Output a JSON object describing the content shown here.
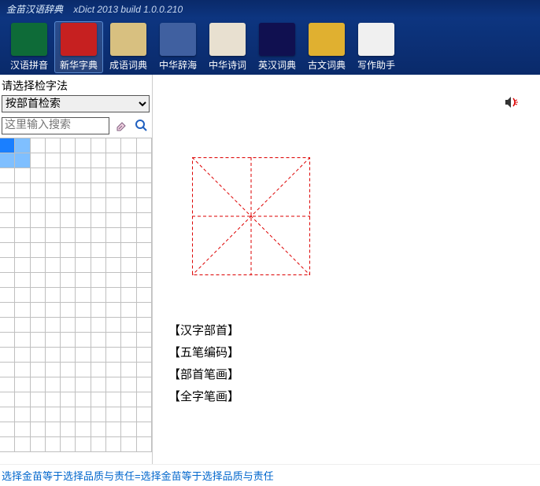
{
  "title": {
    "product": "金苗汉语辞典",
    "version": "xDict 2013  build 1.0.0.210"
  },
  "tools": [
    {
      "label": "汉语拼音",
      "name": "tool-pinyin",
      "bg": "#0e6b38"
    },
    {
      "label": "新华字典",
      "name": "tool-xinhua",
      "bg": "#c62020",
      "selected": true
    },
    {
      "label": "成语词典",
      "name": "tool-chengyu",
      "bg": "#d8c080"
    },
    {
      "label": "中华辞海",
      "name": "tool-cihai",
      "bg": "#4060a0"
    },
    {
      "label": "中华诗词",
      "name": "tool-shici",
      "bg": "#e8e0d0"
    },
    {
      "label": "英汉词典",
      "name": "tool-eng",
      "bg": "#101050"
    },
    {
      "label": "古文词典",
      "name": "tool-guwen",
      "bg": "#e0b030"
    },
    {
      "label": "写作助手",
      "name": "tool-write",
      "bg": "#f0f0f0"
    }
  ],
  "left": {
    "prompt": "请选择检字法",
    "method_selected": "按部首检索",
    "methods": [
      "按部首检索"
    ],
    "search_placeholder": "这里输入搜索"
  },
  "fields": {
    "bushou": "【汉字部首】",
    "wubi": "【五笔编码】",
    "bushou_bihua": "【部首笔画】",
    "quanzi_bihua": "【全字笔画】"
  },
  "footer": "选择金苗等于选择品质与责任=选择金苗等于选择品质与责任",
  "icons": {
    "eraser": "eraser-icon",
    "search": "search-icon",
    "speaker": "speaker-icon"
  }
}
